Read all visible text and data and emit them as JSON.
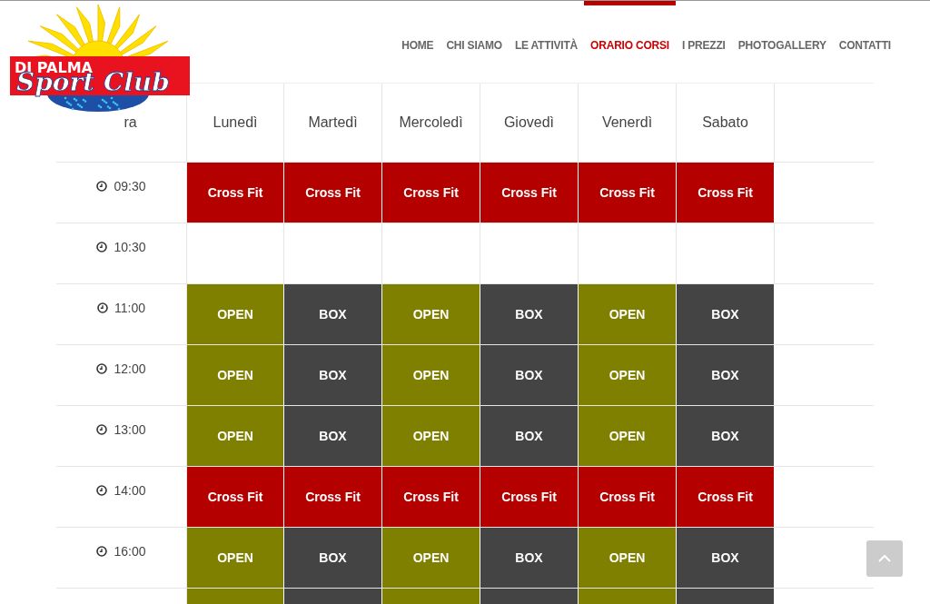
{
  "logo": {
    "line_1": "DI PALMA",
    "line_2": "Sport Club"
  },
  "nav": [
    {
      "label": "HOME",
      "selected": false
    },
    {
      "label": "CHI SIAMO",
      "selected": false
    },
    {
      "label": "LE ATTIVITÀ",
      "selected": false
    },
    {
      "label": "ORARIO CORSI",
      "selected": true
    },
    {
      "label": "I PREZZI",
      "selected": false
    },
    {
      "label": "PHOTOGALLERY",
      "selected": false
    },
    {
      "label": "CONTATTI",
      "selected": false
    }
  ],
  "timetable": {
    "time_heading": "ra",
    "days": [
      "Lunedì",
      "Martedì",
      "Mercoledì",
      "Giovedì",
      "Venerdì",
      "Sabato"
    ],
    "rows": [
      {
        "time": "09:30",
        "cells": [
          {
            "kind": "crossfit",
            "label": "Cross Fit"
          },
          {
            "kind": "crossfit",
            "label": "Cross Fit"
          },
          {
            "kind": "crossfit",
            "label": "Cross Fit"
          },
          {
            "kind": "crossfit",
            "label": "Cross Fit"
          },
          {
            "kind": "crossfit",
            "label": "Cross Fit"
          },
          {
            "kind": "crossfit",
            "label": "Cross Fit"
          }
        ]
      },
      {
        "time": "10:30",
        "cells": [
          {
            "kind": "empty"
          },
          {
            "kind": "empty"
          },
          {
            "kind": "empty"
          },
          {
            "kind": "empty"
          },
          {
            "kind": "empty"
          },
          {
            "kind": "empty"
          }
        ]
      },
      {
        "time": "11:00",
        "cells": [
          {
            "kind": "open",
            "label": "OPEN"
          },
          {
            "kind": "box",
            "label": "BOX"
          },
          {
            "kind": "open",
            "label": "OPEN"
          },
          {
            "kind": "box",
            "label": "BOX"
          },
          {
            "kind": "open",
            "label": "OPEN"
          },
          {
            "kind": "box",
            "label": "BOX"
          }
        ]
      },
      {
        "time": "12:00",
        "cells": [
          {
            "kind": "open",
            "label": "OPEN"
          },
          {
            "kind": "box",
            "label": "BOX"
          },
          {
            "kind": "open",
            "label": "OPEN"
          },
          {
            "kind": "box",
            "label": "BOX"
          },
          {
            "kind": "open",
            "label": "OPEN"
          },
          {
            "kind": "box",
            "label": "BOX"
          }
        ]
      },
      {
        "time": "13:00",
        "cells": [
          {
            "kind": "open",
            "label": "OPEN"
          },
          {
            "kind": "box",
            "label": "BOX"
          },
          {
            "kind": "open",
            "label": "OPEN"
          },
          {
            "kind": "box",
            "label": "BOX"
          },
          {
            "kind": "open",
            "label": "OPEN"
          },
          {
            "kind": "box",
            "label": "BOX"
          }
        ]
      },
      {
        "time": "14:00",
        "cells": [
          {
            "kind": "crossfit",
            "label": "Cross Fit"
          },
          {
            "kind": "crossfit",
            "label": "Cross Fit"
          },
          {
            "kind": "crossfit",
            "label": "Cross Fit"
          },
          {
            "kind": "crossfit",
            "label": "Cross Fit"
          },
          {
            "kind": "crossfit",
            "label": "Cross Fit"
          },
          {
            "kind": "crossfit",
            "label": "Cross Fit"
          }
        ]
      },
      {
        "time": "16:00",
        "cells": [
          {
            "kind": "open",
            "label": "OPEN"
          },
          {
            "kind": "box",
            "label": "BOX"
          },
          {
            "kind": "open",
            "label": "OPEN"
          },
          {
            "kind": "box",
            "label": "BOX"
          },
          {
            "kind": "open",
            "label": "OPEN"
          },
          {
            "kind": "box",
            "label": "BOX"
          }
        ]
      },
      {
        "cells": [
          {
            "kind": "open"
          },
          {
            "kind": "box"
          },
          {
            "kind": "open"
          },
          {
            "kind": "box"
          },
          {
            "kind": "open"
          },
          {
            "kind": "box"
          }
        ]
      }
    ]
  }
}
